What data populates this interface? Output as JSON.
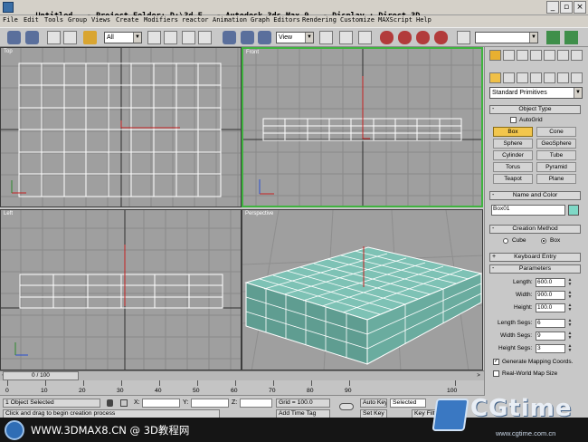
{
  "window": {
    "title_parts": [
      "Untitled",
      "-",
      "Project Folder: D:\\3d_F",
      "-",
      "Autodesk 3ds Max 9",
      "-",
      "Display : Direct 3D"
    ],
    "controls": [
      "_",
      "▫",
      "×"
    ]
  },
  "menu": [
    "File",
    "Edit",
    "Tools",
    "Group",
    "Views",
    "Create",
    "Modifiers",
    "reactor",
    "Animation",
    "Graph Editors",
    "Rendering",
    "Customize",
    "MAXScript",
    "Help"
  ],
  "toolbar": {
    "selection_filter": "All",
    "reference_coord": "View"
  },
  "viewports": {
    "top": {
      "label": "Top"
    },
    "front": {
      "label": "Front"
    },
    "left": {
      "label": "Left"
    },
    "perspective": {
      "label": "Perspective"
    }
  },
  "command_panel": {
    "category": "Standard Primitives",
    "object_type": {
      "header": "Object Type",
      "autogrid": "AutoGrid",
      "buttons": [
        "Box",
        "Cone",
        "Sphere",
        "GeoSphere",
        "Cylinder",
        "Tube",
        "Torus",
        "Pyramid",
        "Teapot",
        "Plane"
      ],
      "active": "Box"
    },
    "name_and_color": {
      "header": "Name and Color",
      "name": "Box01",
      "color": "#7fd8c6"
    },
    "creation_method": {
      "header": "Creation Method",
      "cube": "Cube",
      "box": "Box",
      "selected": "Box"
    },
    "keyboard_entry": {
      "header": "Keyboard Entry"
    },
    "parameters": {
      "header": "Parameters",
      "length_label": "Length:",
      "length": "600.0",
      "width_label": "Width:",
      "width": "900.0",
      "height_label": "Height:",
      "height": "100.0",
      "length_segs_label": "Length Segs:",
      "length_segs": "6",
      "width_segs_label": "Width Segs:",
      "width_segs": "9",
      "height_segs_label": "Height Segs:",
      "height_segs": "3",
      "gen_mapping": "Generate Mapping Coords.",
      "gen_mapping_checked": true,
      "real_world": "Real-World Map Size",
      "real_world_checked": false
    }
  },
  "timeline": {
    "slider": "0 / 100",
    "ticks": [
      "0",
      "10",
      "20",
      "30",
      "40",
      "50",
      "60",
      "70",
      "80",
      "90",
      "100"
    ]
  },
  "status": {
    "selection": "1 Object Selected",
    "prompt": "Click and drag to begin creation process",
    "x_label": "X:",
    "y_label": "Y:",
    "z_label": "Z:",
    "grid": "Grid = 100.0",
    "add_time_tag": "Add Time Tag",
    "auto_key": "Auto Key",
    "selected": "Selected",
    "set_key": "Set Key",
    "key_filters": "Key Filters..."
  },
  "watermark": {
    "text": "WWW.3DMAX8.CN @ 3D教程网",
    "corner_big": "CGtime",
    "corner_small": "www.cgtime.com.cn"
  }
}
